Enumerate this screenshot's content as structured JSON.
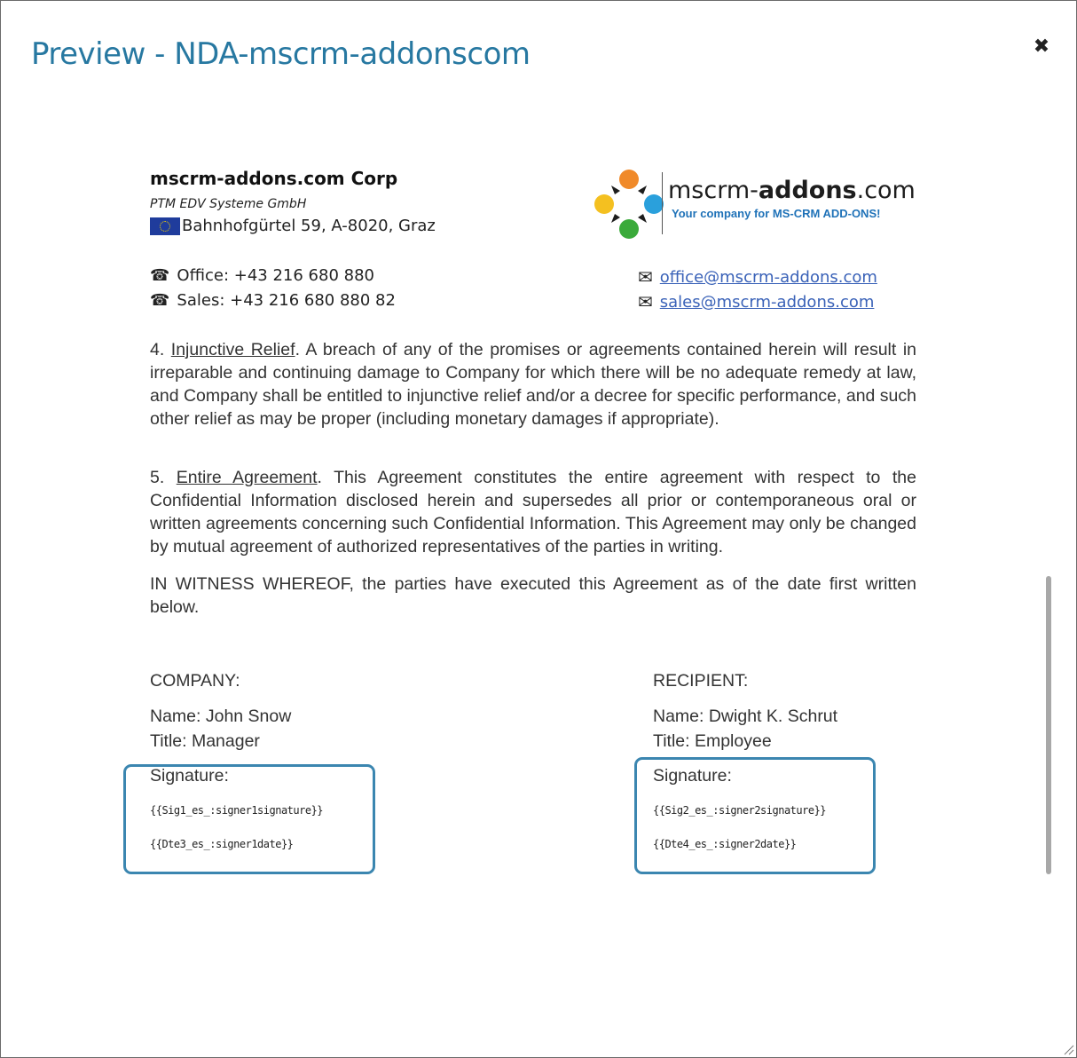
{
  "dialog": {
    "title": "Preview - NDA-mscrm-addonscom",
    "close_glyph": "✖",
    "close_icon": "close-icon"
  },
  "letterhead": {
    "company_name": "mscrm-addons.com Corp",
    "subtitle": "PTM EDV Systeme GmbH",
    "address": "Bahnhofgürtel 59, A-8020, Graz",
    "office_phone": "Office: +43 216 680 880",
    "sales_phone": "Sales: +43 216 680 880 82",
    "office_email": "office@mscrm-addons.com",
    "sales_email": "sales@mscrm-addons.com",
    "phone_glyph": "☎",
    "mail_glyph": "✉",
    "logo": {
      "name_prefix": "mscrm-",
      "name_bold": "addons",
      "name_suffix": ".com",
      "tagline": "Your company for MS-CRM ADD-ONS!",
      "colors": {
        "orange": "#f08a2a",
        "blue": "#2aa0dc",
        "green": "#3aaa3a",
        "yellow": "#f4c020",
        "dark": "#1d1d1d"
      }
    }
  },
  "body": {
    "section4": {
      "number": "4. ",
      "heading": "Injunctive Relief",
      "text": ". A breach of any of the promises or agreements contained herein will result in irreparable and continuing damage to Company for which there will be no adequate remedy at law, and Company shall be entitled to injunctive relief and/or a decree for specific performance, and such other relief as may be proper (including monetary damages if appropriate)."
    },
    "section5": {
      "number": "5. ",
      "heading": "Entire Agreement",
      "text": ". This Agreement constitutes the entire agreement with respect to the Confidential Information disclosed herein and supersedes all prior or contemporaneous oral or written agreements concerning such Confidential Information. This Agreement may only be changed by mutual agreement of authorized representatives of the parties in writing."
    },
    "witness": " IN WITNESS WHEREOF, the parties have executed this Agreement as of the date first written below."
  },
  "company": {
    "heading": "COMPANY:",
    "name": "Name: John Snow",
    "title": "Title: Manager",
    "signature_label": "Signature:",
    "signature_tag": "{{Sig1_es_:signer1signature}}",
    "date_tag": "{{Dte3_es_:signer1date}}"
  },
  "recipient": {
    "heading": "RECIPIENT:",
    "name": "Name:  Dwight K. Schrut",
    "title": "Title: Employee",
    "signature_label": "Signature:",
    "signature_tag": "{{Sig2_es_:signer2signature}}",
    "date_tag": "{{Dte4_es_:signer2date}}"
  },
  "colors": {
    "title": "#2778a1",
    "sig_border": "#3b86b0",
    "link": "#3a62b8"
  }
}
